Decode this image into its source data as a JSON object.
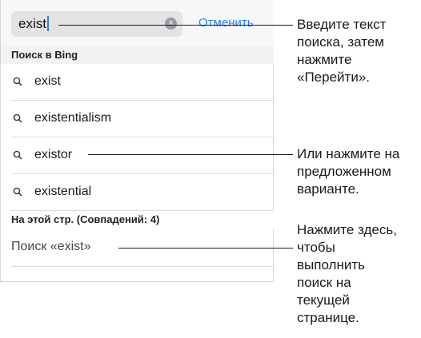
{
  "search_bar": {
    "query": "exist",
    "cancel_label": "Отменить"
  },
  "bing_section": {
    "header": "Поиск в Bing",
    "suggestions": [
      {
        "label": "exist"
      },
      {
        "label": "existentialism"
      },
      {
        "label": "existor"
      },
      {
        "label": "existential"
      }
    ]
  },
  "page_section": {
    "header": "На этой стр. (Совпадений: 4)",
    "find_label": "Поиск «exist»"
  },
  "callouts": {
    "search_text": "Введите текст\nпоиска, затем\nнажмите\n«Перейти».",
    "suggestion": "Или нажмите на\nпредложенном\nварианте.",
    "find_on_page": "Нажмите здесь,\nчтобы\nвыполнить\nпоиск на\nтекущей\nстранице."
  },
  "colors": {
    "accent": "#2f7cf6",
    "caret": "#3b7be0"
  }
}
